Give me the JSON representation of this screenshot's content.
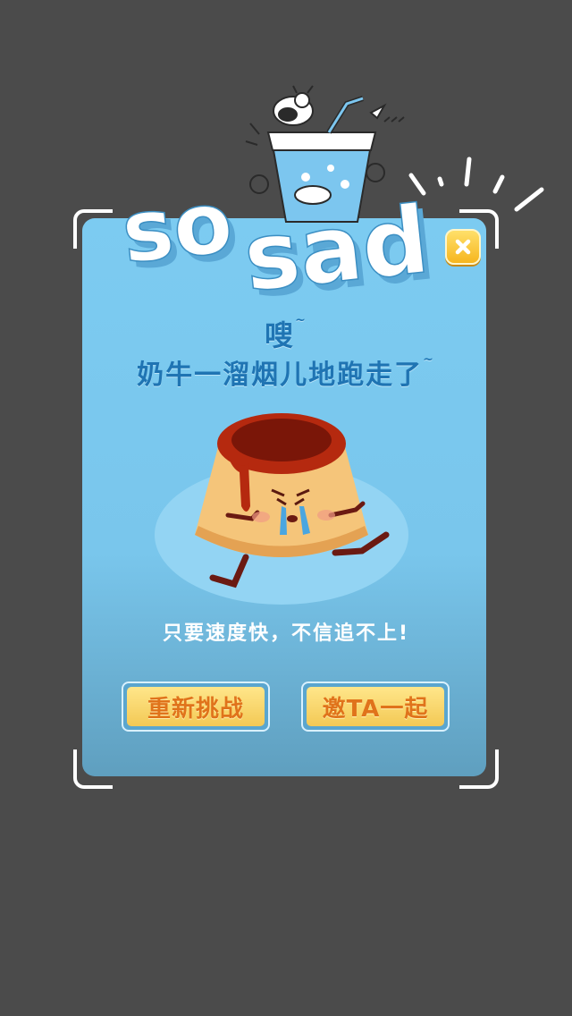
{
  "title_art": {
    "text_line1": "so",
    "text_line2": "sad"
  },
  "headline": {
    "line1": "嗖",
    "line2": "奶牛一溜烟儿地跑走了",
    "tilde": "~"
  },
  "subtitle": "只要速度快，不信追不上!",
  "buttons": {
    "retry": "重新挑战",
    "invite": "邀TA一起"
  },
  "icons": {
    "close": "close-icon",
    "pudding": "crying-pudding-illustration",
    "cow_drink": "cow-drink-illustration"
  },
  "colors": {
    "background": "#4b4b4b",
    "card": "#7ccbf1",
    "accent": "#1f74b3",
    "button": "#f3c955",
    "button_text": "#e0731b"
  }
}
